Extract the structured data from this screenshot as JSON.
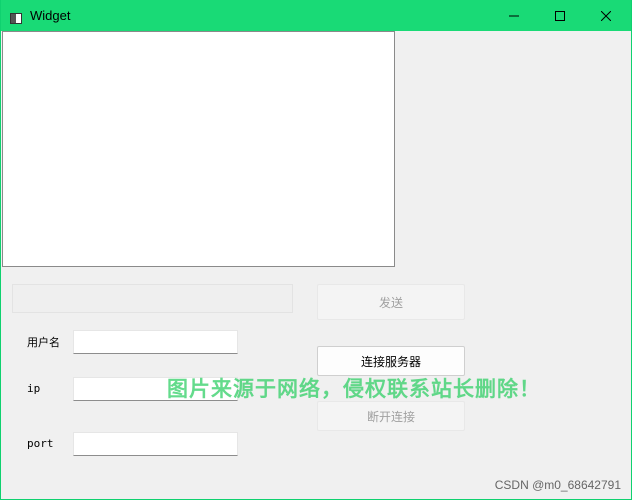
{
  "window": {
    "title": "Widget",
    "titlebar_color": "#19da76",
    "controls": {
      "minimize_icon": "minimize-icon",
      "maximize_icon": "maximize-icon",
      "close_icon": "close-icon"
    }
  },
  "main": {
    "display_text": "",
    "send_input_value": "",
    "send_button_label": "发送",
    "connect_button_label": "连接服务器",
    "disconnect_button_label": "断开连接",
    "fields": {
      "username_label": "用户名",
      "username_value": "",
      "ip_label": "ip",
      "ip_value": "",
      "port_label": "port",
      "port_value": ""
    }
  },
  "overlay": {
    "watermark": "图片来源于网络，侵权联系站长删除！",
    "credit": "CSDN @m0_68642791"
  }
}
